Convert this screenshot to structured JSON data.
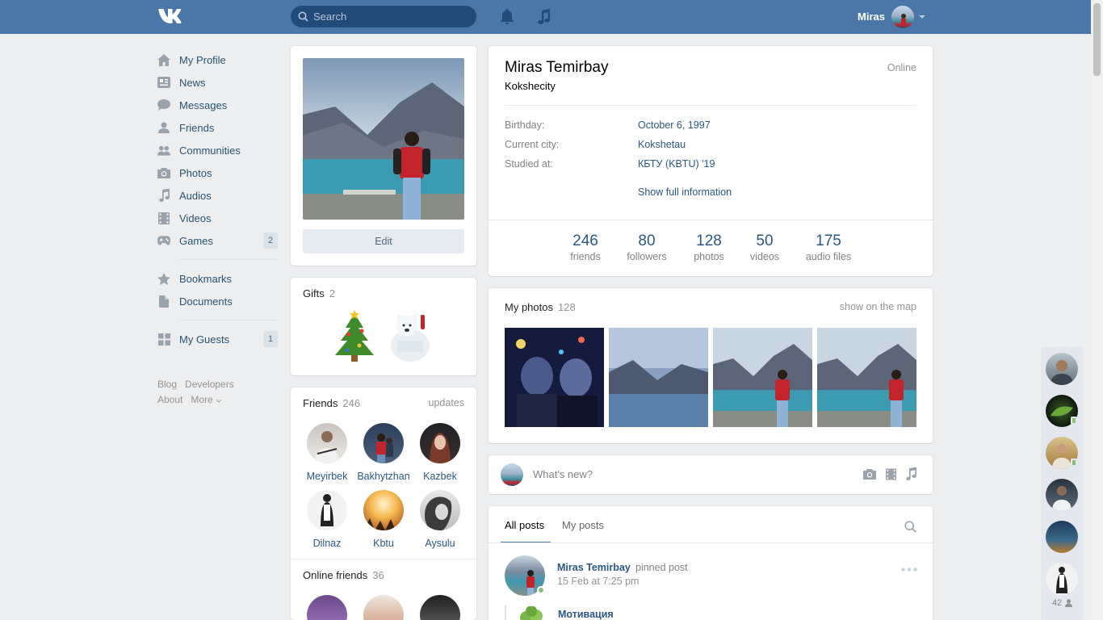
{
  "header": {
    "search_placeholder": "Search",
    "user_name": "Miras"
  },
  "nav": {
    "items": [
      {
        "label": "My Profile",
        "icon": "home-icon"
      },
      {
        "label": "News",
        "icon": "news-icon"
      },
      {
        "label": "Messages",
        "icon": "messages-icon"
      },
      {
        "label": "Friends",
        "icon": "friend-icon"
      },
      {
        "label": "Communities",
        "icon": "communities-icon"
      },
      {
        "label": "Photos",
        "icon": "camera-icon"
      },
      {
        "label": "Audios",
        "icon": "music-icon"
      },
      {
        "label": "Videos",
        "icon": "video-icon"
      },
      {
        "label": "Games",
        "icon": "gamepad-icon",
        "count": "2"
      },
      {
        "label": "Bookmarks",
        "icon": "star-icon"
      },
      {
        "label": "Documents",
        "icon": "document-icon"
      },
      {
        "label": "My Guests",
        "icon": "apps-icon",
        "count": "1"
      }
    ],
    "footer": {
      "blog": "Blog",
      "developers": "Developers",
      "about": "About",
      "more": "More"
    }
  },
  "avatar_card": {
    "edit_label": "Edit"
  },
  "gifts": {
    "title": "Gifts",
    "count": "2"
  },
  "friends_block": {
    "title": "Friends",
    "count": "246",
    "updates": "updates",
    "friends": [
      "Meyirbek",
      "Bakhytzhan",
      "Kazbek",
      "Dilnaz",
      "Kbtu",
      "Aysulu"
    ]
  },
  "online_friends": {
    "title": "Online friends",
    "count": "36"
  },
  "profile": {
    "name": "Miras Temirbay",
    "status": "Kokshecity",
    "online": "Online",
    "rows": [
      {
        "label": "Birthday:",
        "value": "October 6, 1997"
      },
      {
        "label": "Current city:",
        "value": "Kokshetau"
      },
      {
        "label": "Studied at:",
        "value": "КБТУ (KBTU) '19"
      }
    ],
    "show_full": "Show full information",
    "counters": [
      {
        "num": "246",
        "label": "friends"
      },
      {
        "num": "80",
        "label": "followers"
      },
      {
        "num": "128",
        "label": "photos"
      },
      {
        "num": "50",
        "label": "videos"
      },
      {
        "num": "175",
        "label": "audio files"
      }
    ]
  },
  "photos": {
    "title": "My photos",
    "count": "128",
    "map_link": "show on the map"
  },
  "composer": {
    "placeholder": "What's new?"
  },
  "posts": {
    "tab_all": "All posts",
    "tab_mine": "My posts",
    "author": "Miras Temirbay",
    "pinned": "pinned post",
    "date": "15 Feb at 7:25 pm",
    "repost_title": "Мотивация"
  },
  "rail": {
    "online_count": "42"
  }
}
